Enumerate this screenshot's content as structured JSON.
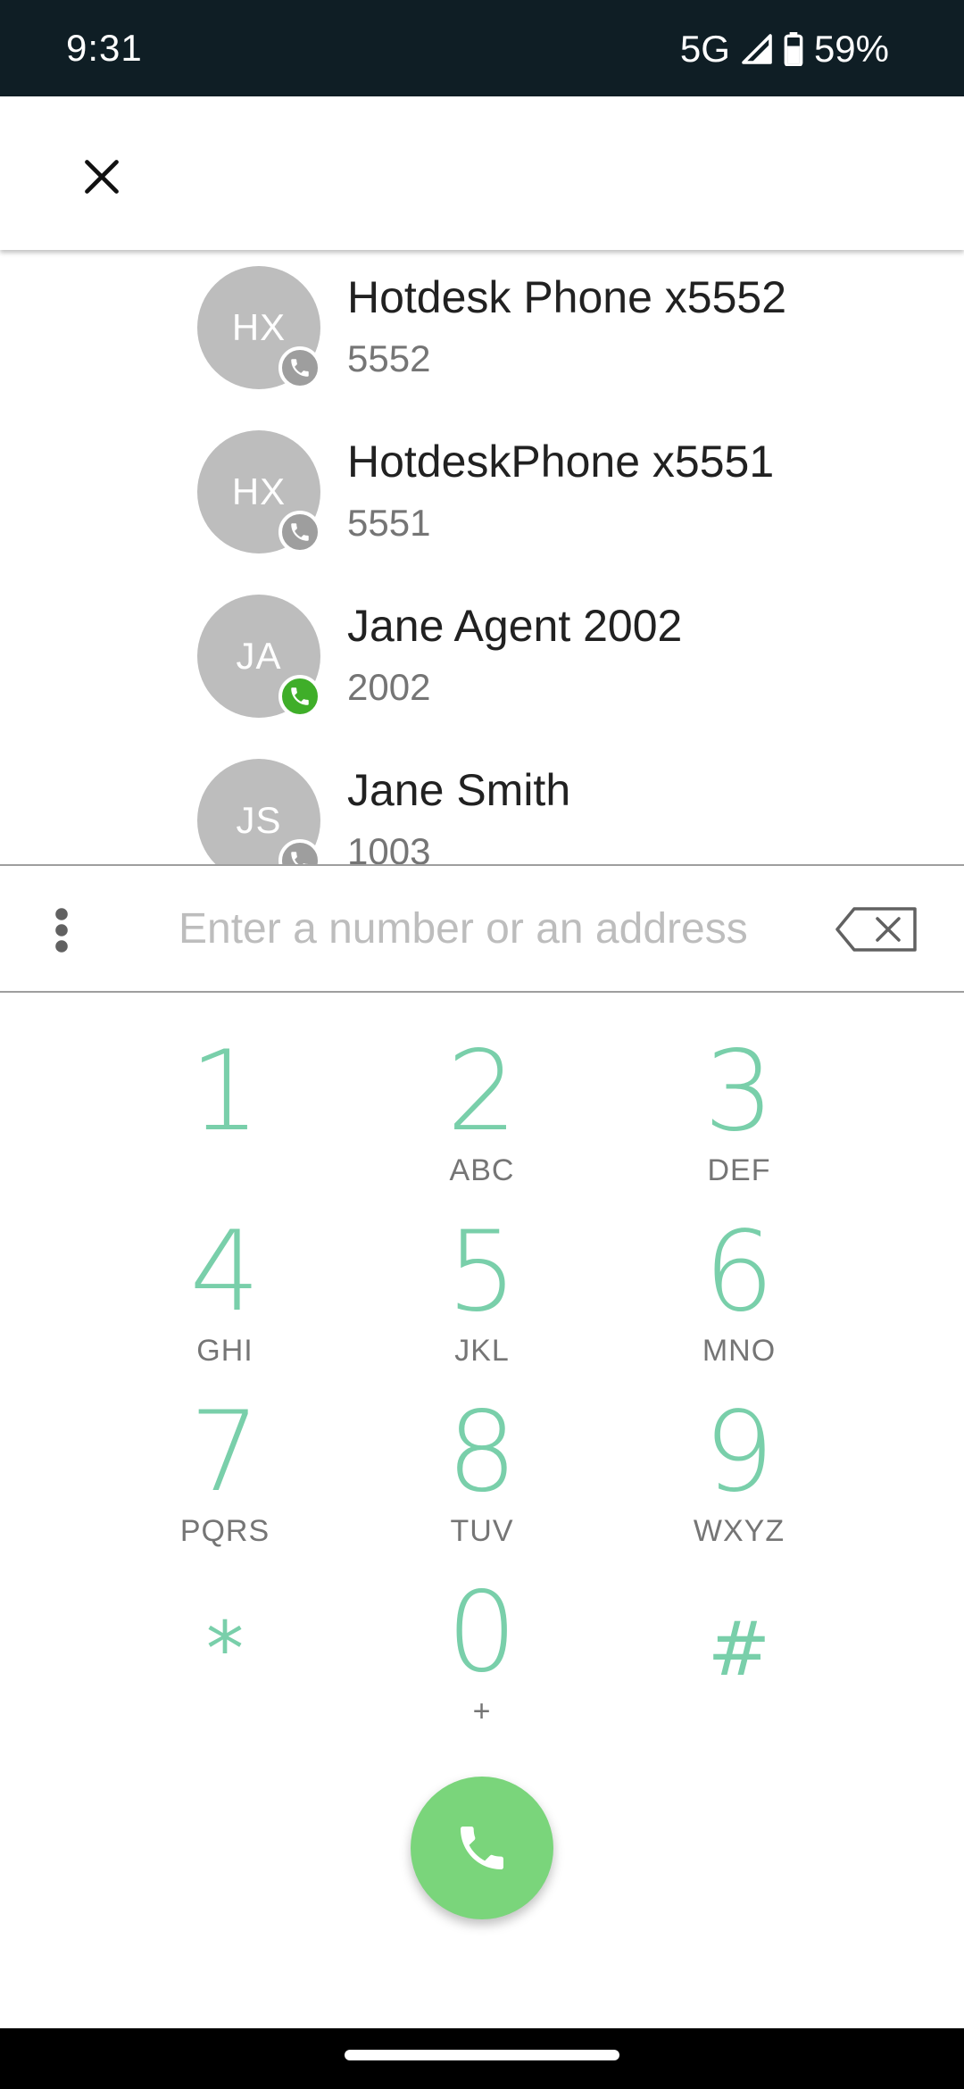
{
  "status_bar": {
    "time": "9:31",
    "network": "5G",
    "battery": "59%"
  },
  "app_bar": {
    "close_icon": "close-icon"
  },
  "contacts": [
    {
      "initials": "HX",
      "name": "Hotdesk Phone x5552",
      "number": "5552",
      "presence": "offline"
    },
    {
      "initials": "HX",
      "name": "HotdeskPhone x5551",
      "number": "5551",
      "presence": "offline"
    },
    {
      "initials": "JA",
      "name": "Jane Agent 2002",
      "number": "2002",
      "presence": "available"
    },
    {
      "initials": "JS",
      "name": "Jane Smith",
      "number": "1003",
      "presence": "offline"
    }
  ],
  "dial_input": {
    "value": "",
    "placeholder": "Enter a number or an address"
  },
  "keypad": [
    {
      "digit": "1",
      "letters": ""
    },
    {
      "digit": "2",
      "letters": "ABC"
    },
    {
      "digit": "3",
      "letters": "DEF"
    },
    {
      "digit": "4",
      "letters": "GHI"
    },
    {
      "digit": "5",
      "letters": "JKL"
    },
    {
      "digit": "6",
      "letters": "MNO"
    },
    {
      "digit": "7",
      "letters": "PQRS"
    },
    {
      "digit": "8",
      "letters": "TUV"
    },
    {
      "digit": "9",
      "letters": "WXYZ"
    },
    {
      "digit": "*",
      "letters": ""
    },
    {
      "digit": "0",
      "letters": "+"
    },
    {
      "digit": "#",
      "letters": ""
    }
  ],
  "colors": {
    "accent": "#79cfaa",
    "call_button": "#7ad57b",
    "presence_available": "#3fae29",
    "presence_offline": "#9e9e9e",
    "status_bar_bg": "#0f1e25"
  }
}
